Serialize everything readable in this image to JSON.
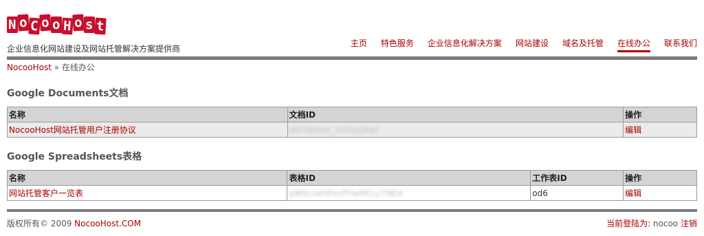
{
  "header": {
    "logo_letters": [
      "N",
      "o",
      "C",
      "o",
      "o",
      "H",
      "o",
      "s",
      "t"
    ],
    "tagline": "企业信息化网站建设及网站托管解决方案提供商"
  },
  "nav": {
    "items": [
      {
        "label": "主页"
      },
      {
        "label": "特色服务"
      },
      {
        "label": "企业信息化解决方案"
      },
      {
        "label": "网站建设"
      },
      {
        "label": "域名及托管"
      },
      {
        "label": "在线办公"
      },
      {
        "label": "联系我们"
      }
    ],
    "active_index": 5
  },
  "breadcrumb": {
    "home": "NocooHost",
    "separator": " » ",
    "current": "在线办公"
  },
  "documents": {
    "title": "Google Documents文档",
    "headers": [
      "名称",
      "文档ID",
      "操作"
    ],
    "rows": [
      {
        "name": "NocooHost网站托管用户注册协议",
        "id": "dd7fddqw_3chhuj9qd",
        "action": "编辑"
      }
    ]
  },
  "spreadsheets": {
    "title": "Google Spreadsheets表格",
    "headers": [
      "名称",
      "表格ID",
      "工作表ID",
      "操作"
    ],
    "rows": [
      {
        "name": "网站托管客户一览表",
        "id": "pNhLcwHFkvPYwMCLcTNEA",
        "sheet": "od6",
        "action": "编辑"
      }
    ]
  },
  "footer": {
    "copyright": "版权所有© 2009 ",
    "site": "NocooHost.COM",
    "login_prefix": "当前登陆为: ",
    "user": "nocoo",
    "logout": "注销"
  },
  "colors": {
    "accent": "#a80000",
    "logo_bg": "#c8102e",
    "bar": "#7a7a7a",
    "table_header": "#d4d4d4"
  }
}
